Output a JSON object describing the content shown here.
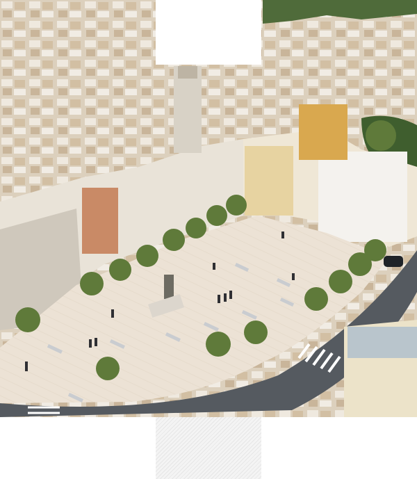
{
  "scene": {
    "subject": "aerial-rendering-town-square",
    "palette": {
      "rooftops": "#d9cdb8",
      "buildings": "#ece6da",
      "paving": "#ebe0d4",
      "road": "#555a60",
      "trees": "#5f7a3a",
      "bell_tower": "#d8d2c6"
    }
  },
  "overlays": {
    "top_block_color": "#ffffff",
    "bottom_hatch_color": "#e6e6e6"
  }
}
